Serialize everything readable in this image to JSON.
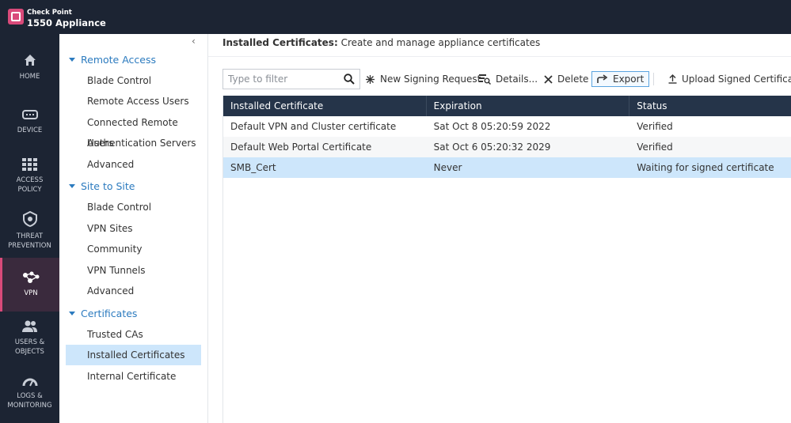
{
  "app": {
    "brand_small": "Check Point",
    "brand_large": "1550 Appliance"
  },
  "leftnav": [
    {
      "label": "HOME",
      "icon": "home-icon"
    },
    {
      "label": "DEVICE",
      "icon": "device-icon"
    },
    {
      "label": "ACCESS POLICY",
      "icon": "grid-icon"
    },
    {
      "label": "THREAT PREVENTION",
      "icon": "shield-icon"
    },
    {
      "label": "VPN",
      "icon": "network-icon",
      "active": true
    },
    {
      "label": "USERS & OBJECTS",
      "icon": "users-icon"
    },
    {
      "label": "LOGS & MONITORING",
      "icon": "gauge-icon"
    }
  ],
  "sidebar": {
    "collapse": "‹",
    "groups": [
      {
        "label": "Remote Access",
        "items": [
          "Blade Control",
          "Remote Access Users",
          "Connected Remote Users",
          "Authentication Servers",
          "Advanced"
        ]
      },
      {
        "label": "Site to Site",
        "items": [
          "Blade Control",
          "VPN Sites",
          "Community",
          "VPN Tunnels",
          "Advanced"
        ]
      },
      {
        "label": "Certificates",
        "items": [
          "Trusted CAs",
          "Installed Certificates",
          "Internal Certificate"
        ]
      }
    ],
    "selected": "Installed Certificates"
  },
  "main": {
    "title_bold": "Installed Certificates:",
    "title_rest": " Create and manage appliance certificates",
    "filter_placeholder": "Type to filter",
    "toolbar": {
      "new_signing_request": "New Signing Request",
      "details": "Details...",
      "delete": "Delete",
      "export": "Export",
      "upload": "Upload Signed Certificate"
    },
    "table": {
      "headers": [
        "Installed Certificate",
        "Expiration",
        "Status"
      ],
      "rows": [
        [
          "Default VPN and Cluster certificate",
          "Sat Oct 8 05:20:59 2022",
          "Verified"
        ],
        [
          "Default Web Portal Certificate",
          "Sat Oct 6 05:20:32 2029",
          "Verified"
        ],
        [
          "SMB_Cert",
          "Never",
          "Waiting for signed certificate"
        ]
      ]
    }
  },
  "colors": {
    "topbar": "#1c2433",
    "accent": "#d94a7a",
    "link": "#2c7bbf",
    "selection": "#cde6fb",
    "table_header": "#253449"
  }
}
